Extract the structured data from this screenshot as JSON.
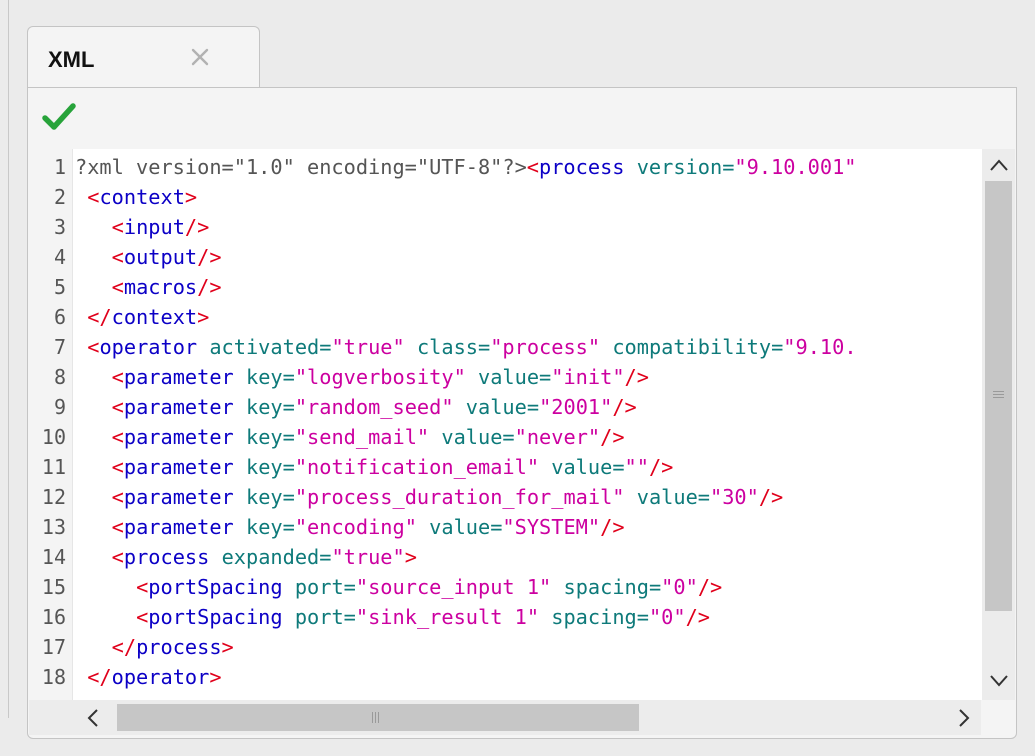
{
  "tab": {
    "title": "XML",
    "close_icon": "close-x-icon"
  },
  "status": {
    "icon": "check-icon",
    "color": "#27a33a"
  },
  "editor": {
    "line_numbers": [
      "1",
      "2",
      "3",
      "4",
      "5",
      "6",
      "7",
      "8",
      "9",
      "10",
      "11",
      "12",
      "13",
      "14",
      "15",
      "16",
      "17",
      "18"
    ],
    "lines": [
      [
        [
          "decl",
          "?xml version=\"1.0\" encoding=\"UTF-8\"?>"
        ],
        [
          "tag",
          "<"
        ],
        [
          "name",
          "process"
        ],
        [
          "text",
          " "
        ],
        [
          "attr",
          "version="
        ],
        [
          "val",
          "\"9.10.001\""
        ]
      ],
      [
        [
          "text",
          " "
        ],
        [
          "tag",
          "<"
        ],
        [
          "name",
          "context"
        ],
        [
          "tag",
          ">"
        ]
      ],
      [
        [
          "text",
          "   "
        ],
        [
          "tag",
          "<"
        ],
        [
          "name",
          "input"
        ],
        [
          "tag",
          "/>"
        ]
      ],
      [
        [
          "text",
          "   "
        ],
        [
          "tag",
          "<"
        ],
        [
          "name",
          "output"
        ],
        [
          "tag",
          "/>"
        ]
      ],
      [
        [
          "text",
          "   "
        ],
        [
          "tag",
          "<"
        ],
        [
          "name",
          "macros"
        ],
        [
          "tag",
          "/>"
        ]
      ],
      [
        [
          "text",
          " "
        ],
        [
          "tag",
          "</"
        ],
        [
          "name",
          "context"
        ],
        [
          "tag",
          ">"
        ]
      ],
      [
        [
          "text",
          " "
        ],
        [
          "tag",
          "<"
        ],
        [
          "name",
          "operator"
        ],
        [
          "text",
          " "
        ],
        [
          "attr",
          "activated="
        ],
        [
          "val",
          "\"true\""
        ],
        [
          "text",
          " "
        ],
        [
          "attr",
          "class="
        ],
        [
          "val",
          "\"process\""
        ],
        [
          "text",
          " "
        ],
        [
          "attr",
          "compatibility="
        ],
        [
          "val",
          "\"9.10."
        ]
      ],
      [
        [
          "text",
          "   "
        ],
        [
          "tag",
          "<"
        ],
        [
          "name",
          "parameter"
        ],
        [
          "text",
          " "
        ],
        [
          "attr",
          "key="
        ],
        [
          "val",
          "\"logverbosity\""
        ],
        [
          "text",
          " "
        ],
        [
          "attr",
          "value="
        ],
        [
          "val",
          "\"init\""
        ],
        [
          "tag",
          "/>"
        ]
      ],
      [
        [
          "text",
          "   "
        ],
        [
          "tag",
          "<"
        ],
        [
          "name",
          "parameter"
        ],
        [
          "text",
          " "
        ],
        [
          "attr",
          "key="
        ],
        [
          "val",
          "\"random_seed\""
        ],
        [
          "text",
          " "
        ],
        [
          "attr",
          "value="
        ],
        [
          "val",
          "\"2001\""
        ],
        [
          "tag",
          "/>"
        ]
      ],
      [
        [
          "text",
          "   "
        ],
        [
          "tag",
          "<"
        ],
        [
          "name",
          "parameter"
        ],
        [
          "text",
          " "
        ],
        [
          "attr",
          "key="
        ],
        [
          "val",
          "\"send_mail\""
        ],
        [
          "text",
          " "
        ],
        [
          "attr",
          "value="
        ],
        [
          "val",
          "\"never\""
        ],
        [
          "tag",
          "/>"
        ]
      ],
      [
        [
          "text",
          "   "
        ],
        [
          "tag",
          "<"
        ],
        [
          "name",
          "parameter"
        ],
        [
          "text",
          " "
        ],
        [
          "attr",
          "key="
        ],
        [
          "val",
          "\"notification_email\""
        ],
        [
          "text",
          " "
        ],
        [
          "attr",
          "value="
        ],
        [
          "val",
          "\"\""
        ],
        [
          "tag",
          "/>"
        ]
      ],
      [
        [
          "text",
          "   "
        ],
        [
          "tag",
          "<"
        ],
        [
          "name",
          "parameter"
        ],
        [
          "text",
          " "
        ],
        [
          "attr",
          "key="
        ],
        [
          "val",
          "\"process_duration_for_mail\""
        ],
        [
          "text",
          " "
        ],
        [
          "attr",
          "value="
        ],
        [
          "val",
          "\"30\""
        ],
        [
          "tag",
          "/>"
        ]
      ],
      [
        [
          "text",
          "   "
        ],
        [
          "tag",
          "<"
        ],
        [
          "name",
          "parameter"
        ],
        [
          "text",
          " "
        ],
        [
          "attr",
          "key="
        ],
        [
          "val",
          "\"encoding\""
        ],
        [
          "text",
          " "
        ],
        [
          "attr",
          "value="
        ],
        [
          "val",
          "\"SYSTEM\""
        ],
        [
          "tag",
          "/>"
        ]
      ],
      [
        [
          "text",
          "   "
        ],
        [
          "tag",
          "<"
        ],
        [
          "name",
          "process"
        ],
        [
          "text",
          " "
        ],
        [
          "attr",
          "expanded="
        ],
        [
          "val",
          "\"true\""
        ],
        [
          "tag",
          ">"
        ]
      ],
      [
        [
          "text",
          "     "
        ],
        [
          "tag",
          "<"
        ],
        [
          "name",
          "portSpacing"
        ],
        [
          "text",
          " "
        ],
        [
          "attr",
          "port="
        ],
        [
          "val",
          "\"source_input 1\""
        ],
        [
          "text",
          " "
        ],
        [
          "attr",
          "spacing="
        ],
        [
          "val",
          "\"0\""
        ],
        [
          "tag",
          "/>"
        ]
      ],
      [
        [
          "text",
          "     "
        ],
        [
          "tag",
          "<"
        ],
        [
          "name",
          "portSpacing"
        ],
        [
          "text",
          " "
        ],
        [
          "attr",
          "port="
        ],
        [
          "val",
          "\"sink_result 1\""
        ],
        [
          "text",
          " "
        ],
        [
          "attr",
          "spacing="
        ],
        [
          "val",
          "\"0\""
        ],
        [
          "tag",
          "/>"
        ]
      ],
      [
        [
          "text",
          "   "
        ],
        [
          "tag",
          "</"
        ],
        [
          "name",
          "process"
        ],
        [
          "tag",
          ">"
        ]
      ],
      [
        [
          "text",
          " "
        ],
        [
          "tag",
          "</"
        ],
        [
          "name",
          "operator"
        ],
        [
          "tag",
          ">"
        ]
      ]
    ]
  },
  "scrollbars": {
    "vertical": {
      "up_icon": "chevron-up-icon",
      "down_icon": "chevron-down-icon",
      "grip_icon": "grip-icon"
    },
    "horizontal": {
      "left_icon": "chevron-left-icon",
      "right_icon": "chevron-right-icon",
      "grip_icon": "grip-icon"
    }
  }
}
